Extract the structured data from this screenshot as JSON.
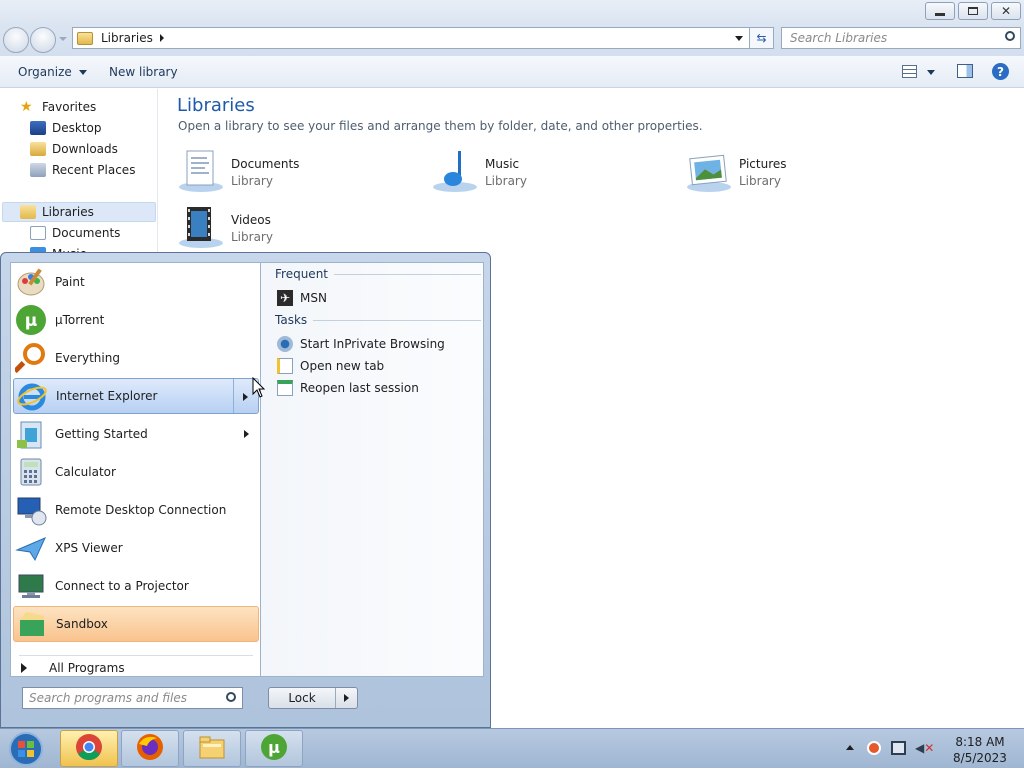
{
  "explorer": {
    "address": "Libraries",
    "search_placeholder": "Search Libraries",
    "toolbar": {
      "organize": "Organize",
      "new_library": "New library"
    },
    "nav": {
      "favorites": "Favorites",
      "desktop": "Desktop",
      "downloads": "Downloads",
      "recent_places": "Recent Places",
      "libraries": "Libraries",
      "documents": "Documents",
      "music_partial": "Music"
    },
    "content": {
      "title": "Libraries",
      "subtitle": "Open a library to see your files and arrange them by folder, date, and other properties.",
      "libraries": [
        {
          "name": "Documents",
          "type": "Library",
          "icon": "documents-library-icon"
        },
        {
          "name": "Music",
          "type": "Library",
          "icon": "music-library-icon"
        },
        {
          "name": "Pictures",
          "type": "Library",
          "icon": "pictures-library-icon"
        },
        {
          "name": "Videos",
          "type": "Library",
          "icon": "videos-library-icon"
        }
      ]
    }
  },
  "start_menu": {
    "programs": [
      {
        "label": "Paint",
        "icon": "paint-icon",
        "submenu": false
      },
      {
        "label": "µTorrent",
        "icon": "utorrent-icon",
        "submenu": false
      },
      {
        "label": "Everything",
        "icon": "everything-icon",
        "submenu": false
      },
      {
        "label": "Internet Explorer",
        "icon": "internet-explorer-icon",
        "submenu": true,
        "state": "hover"
      },
      {
        "label": "Getting Started",
        "icon": "getting-started-icon",
        "submenu": true
      },
      {
        "label": "Calculator",
        "icon": "calculator-icon",
        "submenu": false
      },
      {
        "label": "Remote Desktop Connection",
        "icon": "remote-desktop-icon",
        "submenu": false
      },
      {
        "label": "XPS Viewer",
        "icon": "xps-viewer-icon",
        "submenu": false
      },
      {
        "label": "Connect to a Projector",
        "icon": "projector-icon",
        "submenu": false
      },
      {
        "label": "Sandbox",
        "icon": "sandbox-icon",
        "submenu": false,
        "state": "highlighted"
      }
    ],
    "all_programs": "All Programs",
    "jumplist": {
      "frequent_header": "Frequent",
      "frequent": [
        {
          "label": "MSN",
          "icon": "msn-icon"
        }
      ],
      "tasks_header": "Tasks",
      "tasks": [
        {
          "label": "Start InPrivate Browsing",
          "icon": "inprivate-icon"
        },
        {
          "label": "Open new tab",
          "icon": "new-tab-icon"
        },
        {
          "label": "Reopen last session",
          "icon": "reopen-session-icon"
        }
      ]
    },
    "search_placeholder": "Search programs and files",
    "lock_label": "Lock"
  },
  "taskbar": {
    "apps": [
      "chrome-icon",
      "firefox-icon",
      "file-explorer-icon",
      "utorrent-icon"
    ],
    "clock_time": "8:18 AM",
    "clock_date": "8/5/2023"
  },
  "colors": {
    "accent": "#1e5aa8",
    "highlight": "#f9c38e",
    "hover": "#b7d0f3"
  }
}
